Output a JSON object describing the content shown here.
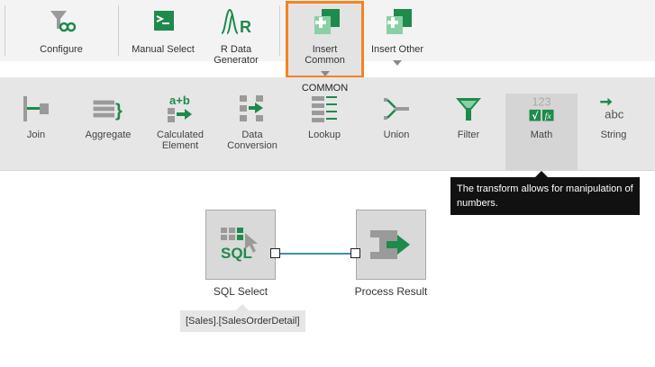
{
  "toolbar": {
    "configure": "Configure",
    "manual_select": "Manual Select",
    "r_data_generator": "R Data\nGenerator",
    "insert_common": "Insert\nCommon",
    "insert_other": "Insert Other",
    "group_title": "COMMON"
  },
  "transforms": {
    "join": "Join",
    "aggregate": "Aggregate",
    "calculated_element": "Calculated\nElement",
    "data_conversion": "Data\nConversion",
    "lookup": "Lookup",
    "union": "Union",
    "filter": "Filter",
    "math": "Math",
    "string": "String"
  },
  "tooltip": {
    "text": "The transform allows for manipulation of numbers."
  },
  "canvas": {
    "sql_select": "SQL Select",
    "process_result": "Process Result",
    "source_table": "[Sales].[SalesOrderDetail]",
    "sql_text": "SQL"
  },
  "icon_text": {
    "r_letter": "R",
    "calc": "a+b",
    "math_digits": "123",
    "math_sqrt": "√",
    "math_fx": "fx",
    "string_abc": "abc"
  },
  "colors": {
    "green": "#1e8a4c",
    "accent_orange": "#f58220",
    "gray_icon": "#9a9a9a",
    "connector": "#3a8fb7"
  }
}
